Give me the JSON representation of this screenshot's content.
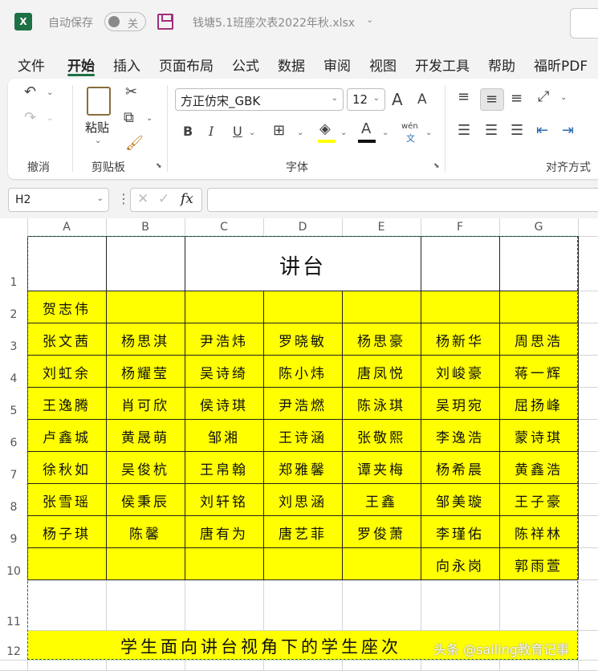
{
  "titlebar": {
    "autosave_label": "自动保存",
    "toggle_label": "关",
    "filename": "钱塘5.1班座次表2022年秋.xlsx"
  },
  "menu": {
    "items": [
      "文件",
      "开始",
      "插入",
      "页面布局",
      "公式",
      "数据",
      "审阅",
      "视图",
      "开发工具",
      "帮助",
      "福昕PDF"
    ],
    "active_index": 1
  },
  "ribbon": {
    "groups": {
      "undo": "撤消",
      "clipboard": "剪贴板",
      "font": "字体",
      "align": "对齐方式"
    },
    "paste_label": "粘贴",
    "font_name": "方正仿宋_GBK",
    "font_size": "12",
    "grow_font": "A",
    "shrink_font": "A",
    "bold": "B",
    "italic": "I",
    "underline": "U",
    "font_color_letter": "A",
    "phonetic_top": "wén",
    "phonetic_bottom": "文"
  },
  "formula": {
    "name_box": "H2",
    "fx": "fx",
    "value": ""
  },
  "sheet": {
    "columns": [
      "A",
      "B",
      "C",
      "D",
      "E",
      "F",
      "G"
    ],
    "rows": [
      "1",
      "2",
      "3",
      "4",
      "5",
      "6",
      "7",
      "8",
      "9",
      "10",
      "11",
      "12"
    ],
    "podium": "讲台",
    "seats": [
      [
        "贺志伟",
        "",
        "",
        "",
        "",
        "",
        ""
      ],
      [
        "张文茜",
        "杨思淇",
        "尹浩炜",
        "罗晓敏",
        "杨思豪",
        "杨新华",
        "周思浩"
      ],
      [
        "刘虹余",
        "杨耀莹",
        "吴诗绮",
        "陈小炜",
        "唐凤悦",
        "刘峻豪",
        "蒋一辉"
      ],
      [
        "王逸腾",
        "肖可欣",
        "侯诗琪",
        "尹浩燃",
        "陈泳琪",
        "吴玥宛",
        "屈扬峰"
      ],
      [
        "卢鑫城",
        "黄晟萌",
        "邹湘",
        "王诗涵",
        "张敬熙",
        "李逸浩",
        "蒙诗琪"
      ],
      [
        "徐秋如",
        "吴俊杭",
        "王帛翰",
        "郑雅馨",
        "谭夹梅",
        "杨希晨",
        "黄鑫浩"
      ],
      [
        "张雪瑶",
        "侯秉辰",
        "刘轩铭",
        "刘思涵",
        "王鑫",
        "邹美璇",
        "王子豪"
      ],
      [
        "杨子琪",
        "陈馨",
        "唐有为",
        "唐艺菲",
        "罗俊萧",
        "李瑾佑",
        "陈祥林"
      ],
      [
        "",
        "",
        "",
        "",
        "",
        "向永岗",
        "郭雨萱"
      ]
    ],
    "footer": "学生面向讲台视角下的学生座次"
  },
  "watermark": "头条 @sailing教育记事",
  "colors": {
    "accent": "#1e7145",
    "highlight": "#ffff00"
  }
}
